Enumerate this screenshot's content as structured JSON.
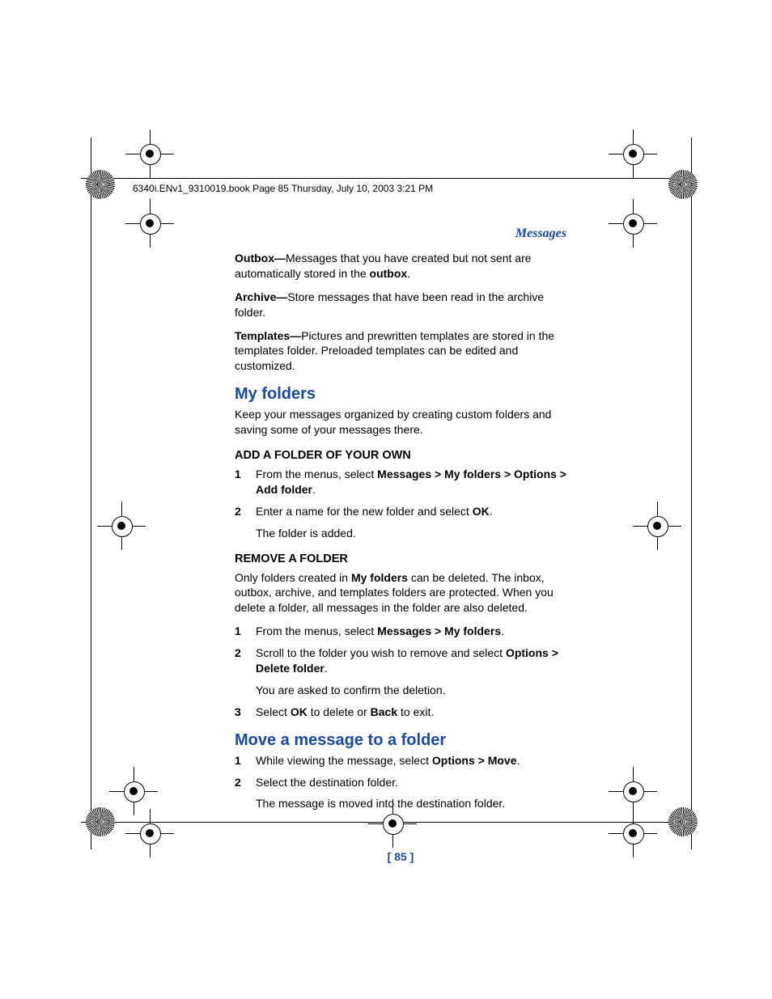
{
  "header": "6340i.ENv1_9310019.book  Page 85  Thursday, July 10, 2003  3:21 PM",
  "section": "Messages",
  "intro": [
    {
      "lead": "Outbox—",
      "rest1": "Messages that you have created but not sent are automatically stored in the ",
      "bold": "outbox",
      "rest2": "."
    },
    {
      "lead": "Archive—",
      "rest1": "Store messages that have been read in the archive folder.",
      "bold": "",
      "rest2": ""
    },
    {
      "lead": "Templates—",
      "rest1": "Pictures and prewritten templates are stored in the templates folder. Preloaded templates can be edited and customized.",
      "bold": "",
      "rest2": ""
    }
  ],
  "myfolders": {
    "title": "My folders",
    "desc": "Keep your messages organized by creating custom folders and saving some of your messages there.",
    "add": {
      "title": "ADD A FOLDER OF YOUR OWN",
      "steps": [
        {
          "n": "1",
          "pre": "From the menus, select ",
          "b": "Messages > My folders > Options > Add folder",
          "post": ".",
          "sub": ""
        },
        {
          "n": "2",
          "pre": "Enter a name for the new folder and select ",
          "b": "OK",
          "post": ".",
          "sub": "The folder is added."
        }
      ]
    },
    "remove": {
      "title": "REMOVE A FOLDER",
      "desc_pre": "Only folders created in ",
      "desc_b": "My folders",
      "desc_post": " can be deleted. The inbox, outbox, archive, and templates folders are protected. When you delete a folder, all messages in the folder are also deleted.",
      "steps": [
        {
          "n": "1",
          "pre": "From the menus, select ",
          "b": "Messages > My folders",
          "post": ".",
          "sub": ""
        },
        {
          "n": "2",
          "pre": "Scroll to the folder you wish to remove and select ",
          "b": "Options > Delete folder",
          "post": ".",
          "sub": "You are asked to confirm the deletion."
        },
        {
          "n": "3",
          "pre": "Select ",
          "b": "OK",
          "mid": " to delete or ",
          "b2": "Back",
          "post": " to exit.",
          "sub": ""
        }
      ]
    }
  },
  "move": {
    "title": "Move a message to a folder",
    "steps": [
      {
        "n": "1",
        "pre": "While viewing the message, select ",
        "b": "Options > Move",
        "post": ".",
        "sub": ""
      },
      {
        "n": "2",
        "pre": "Select the destination folder.",
        "b": "",
        "post": "",
        "sub": "The message is moved into the destination folder."
      }
    ]
  },
  "pagenum": "[ 85 ]"
}
